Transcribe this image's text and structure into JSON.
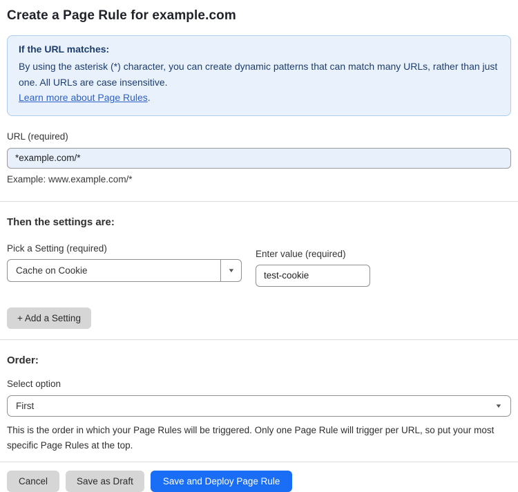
{
  "page": {
    "title": "Create a Page Rule for example.com"
  },
  "info_box": {
    "heading": "If the URL matches:",
    "body": "By using the asterisk (*) character, you can create dynamic patterns that can match many URLs, rather than just one. All URLs are case insensitive.",
    "link": "Learn more about Page Rules",
    "link_suffix": "."
  },
  "url_field": {
    "label": "URL (required)",
    "value": "*example.com/*",
    "example": "Example: www.example.com/*"
  },
  "settings_section": {
    "heading": "Then the settings are:",
    "setting_select": {
      "label": "Pick a Setting (required)",
      "value": "Cache on Cookie"
    },
    "value_input": {
      "label": "Enter value (required)",
      "value": "test-cookie"
    },
    "add_setting_label": "+ Add a Setting"
  },
  "order_section": {
    "heading": "Order:",
    "select_label": "Select option",
    "selected_option": "First",
    "help": "This is the order in which your Page Rules will be triggered. Only one Page Rule will trigger per URL, so put your most specific Page Rules at the top."
  },
  "footer": {
    "cancel_label": "Cancel",
    "save_draft_label": "Save as Draft",
    "save_deploy_label": "Save and Deploy Page Rule"
  },
  "icons": {
    "dropdown_arrow": "▼"
  },
  "colors": {
    "accent_blue": "#1a6ef5",
    "info_background": "#e9f2fc",
    "info_border": "#abcdf0",
    "info_text": "#1d3c6e",
    "link_blue": "#2d5fc8",
    "url_input_background": "#e8f0fc",
    "gray_button": "#d6d6d6"
  }
}
